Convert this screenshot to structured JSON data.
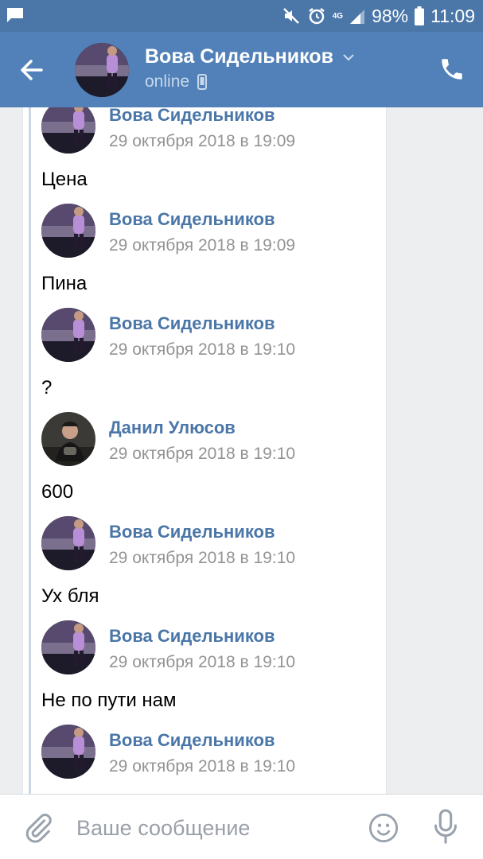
{
  "status_bar": {
    "battery": "98%",
    "time": "11:09",
    "network": "4G",
    "icons": [
      "message-notification-icon",
      "mute-icon",
      "alarm-icon",
      "network-4g-icon",
      "signal-icon",
      "battery-icon"
    ]
  },
  "header": {
    "name": "Вова Сидельников",
    "status": "online",
    "icons": [
      "back-arrow-icon",
      "chevron-down-icon",
      "mobile-device-icon",
      "phone-icon"
    ]
  },
  "messages": [
    {
      "author": "Вова Сидельников",
      "date": "29 октября 2018 в 19:09",
      "text": "Цена",
      "avatar": "vova"
    },
    {
      "author": "Вова Сидельников",
      "date": "29 октября 2018 в 19:09",
      "text": "Пина",
      "avatar": "vova"
    },
    {
      "author": "Вова Сидельников",
      "date": "29 октября 2018 в 19:10",
      "text": "?",
      "avatar": "vova"
    },
    {
      "author": "Данил Улюсов",
      "date": "29 октября 2018 в 19:10",
      "text": "600",
      "avatar": "danil"
    },
    {
      "author": "Вова Сидельников",
      "date": "29 октября 2018 в 19:10",
      "text": "Ух бля",
      "avatar": "vova"
    },
    {
      "author": "Вова Сидельников",
      "date": "29 октября 2018 в 19:10",
      "text": "Не по пути нам",
      "avatar": "vova"
    },
    {
      "author": "Вова Сидельников",
      "date": "29 октября 2018 в 19:10",
      "text": "",
      "avatar": "vova"
    }
  ],
  "composer": {
    "placeholder": "Ваше сообщение",
    "value": "",
    "icons": [
      "paperclip-icon",
      "emoji-icon",
      "microphone-icon"
    ]
  },
  "colors": {
    "header": "#5181b8",
    "status_bar": "#4a76a8",
    "author_link": "#4a76a8",
    "date_gray": "#939393",
    "background": "#edeef0"
  }
}
